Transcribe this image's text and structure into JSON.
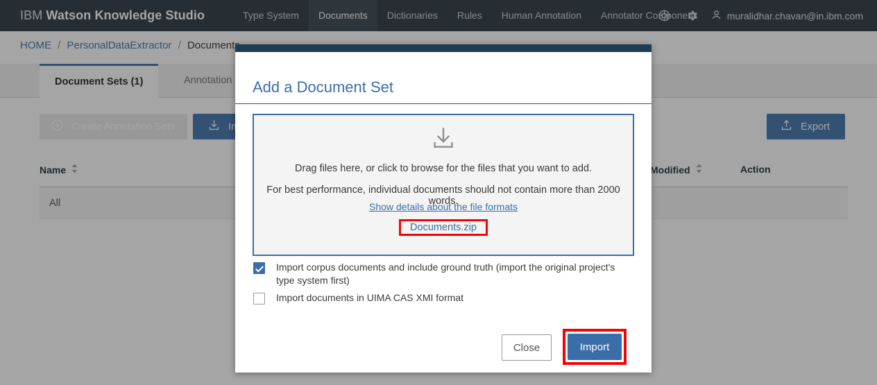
{
  "topnav": {
    "brand_prefix": "IBM",
    "brand_name": "Watson Knowledge Studio",
    "items": [
      {
        "label": "Type System",
        "active": false
      },
      {
        "label": "Documents",
        "active": true
      },
      {
        "label": "Dictionaries",
        "active": false
      },
      {
        "label": "Rules",
        "active": false
      },
      {
        "label": "Human Annotation",
        "active": false
      },
      {
        "label": "Annotator Component",
        "active": false
      }
    ],
    "help_icon": "lifebuoy-icon",
    "settings_icon": "gear-icon",
    "user_icon": "person-icon",
    "user_email": "muralidhar.chavan@in.ibm.com"
  },
  "breadcrumb": {
    "home": "HOME",
    "project": "PersonalDataExtractor",
    "current": "Documents",
    "separator": "/"
  },
  "tabs": [
    {
      "label": "Document Sets (1)",
      "active": true
    },
    {
      "label": "Annotation Sets",
      "active": false
    }
  ],
  "toolbar": {
    "create_annotation_sets": "Create Annotation Sets",
    "create_icon": "plus-circle-icon",
    "import_label": "Import",
    "import_icon": "download-icon",
    "export_label": "Export",
    "export_icon": "upload-icon"
  },
  "table": {
    "columns": [
      {
        "label": "Name",
        "sortable": true
      },
      {
        "label": "Modified",
        "sortable": true
      },
      {
        "label": "Action",
        "sortable": false
      }
    ],
    "rows": [
      {
        "name": "All",
        "modified": "",
        "action": ""
      }
    ]
  },
  "modal": {
    "title": "Add a Document Set",
    "dropzone": {
      "icon": "download-tray-icon",
      "line1": "Drag files here, or click to browse for the files that you want to add.",
      "line2": "For best performance, individual documents should not contain more than 2000 words.",
      "details_link": "Show details about the file formats",
      "file_name": "Documents.zip"
    },
    "options": [
      {
        "checked": true,
        "label": "Import corpus documents and include ground truth (import the original project's type system first)"
      },
      {
        "checked": false,
        "label": "Import documents in UIMA CAS XMI format"
      }
    ],
    "close_label": "Close",
    "import_label": "Import"
  },
  "colors": {
    "nav_bg": "#26323c",
    "nav_active": "#31414d",
    "accent_blue": "#3b6ea8",
    "modal_topbar": "#1f3c52",
    "annotation_red": "#f20505",
    "dropzone_bg": "#f4f4f4"
  }
}
